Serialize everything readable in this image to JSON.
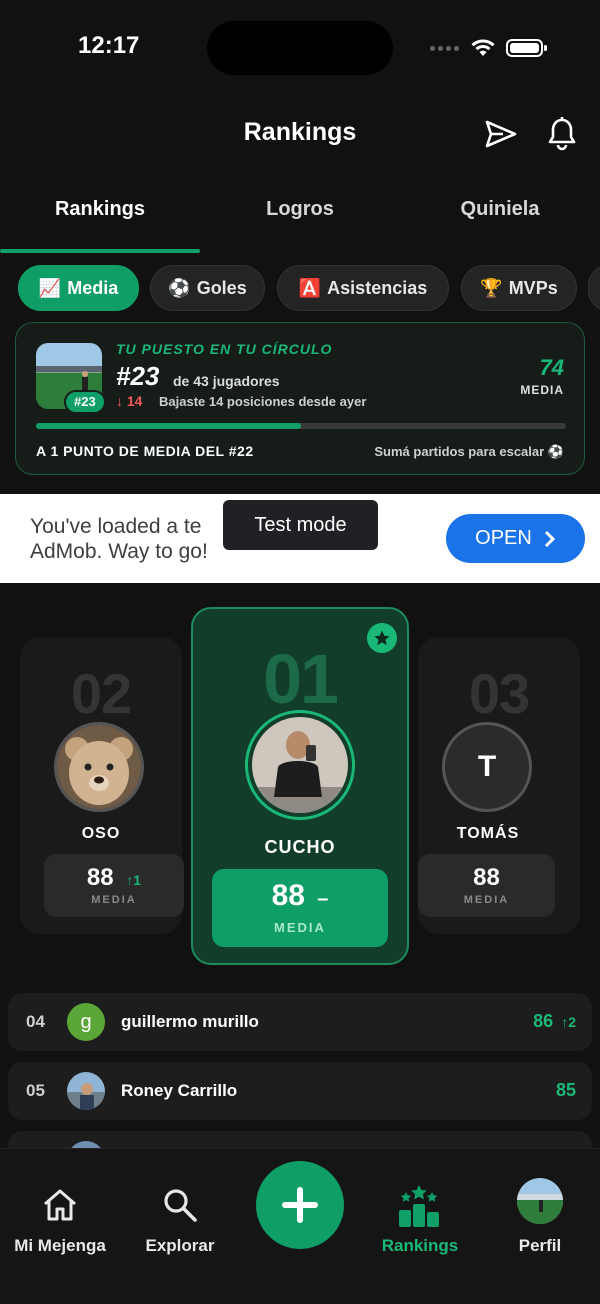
{
  "status_bar": {
    "time": "12:17"
  },
  "header": {
    "title": "Rankings"
  },
  "tabs": [
    {
      "label": "Rankings"
    },
    {
      "label": "Logros"
    },
    {
      "label": "Quiniela"
    }
  ],
  "chips": [
    {
      "icon": "📈",
      "label": "Media"
    },
    {
      "icon": "⚽",
      "label": "Goles"
    },
    {
      "icon": "🅰️",
      "label": "Asistencias"
    },
    {
      "icon": "🏆",
      "label": "MVPs"
    }
  ],
  "position_card": {
    "kicker": "TU PUESTO EN TU CÍRCULO",
    "rank": "#23",
    "of_text": "de 43 jugadores",
    "badge": "#23",
    "change": "↓ 14",
    "change_text": "Bajaste 14 posiciones desde ayer",
    "value": "74",
    "value_label": "MEDIA",
    "progress": 0.5,
    "footer_left": "A 1 PUNTO DE MEDIA DEL #22",
    "footer_right": "Sumá partidos para escalar ⚽"
  },
  "ad": {
    "text_line1": "You've loaded a te",
    "text_line2": "AdMob. Way to go!",
    "button": "OPEN",
    "test_mode": "Test mode"
  },
  "podium": {
    "first": {
      "pos": "01",
      "name": "CUCHO",
      "value": "88",
      "change": "–",
      "label": "MEDIA"
    },
    "second": {
      "pos": "02",
      "name": "OSO",
      "value": "88",
      "change": "↑1",
      "label": "MEDIA"
    },
    "third": {
      "pos": "03",
      "name": "TOMÁS",
      "initial": "T",
      "value": "88",
      "label": "MEDIA"
    }
  },
  "list": [
    {
      "pos": "04",
      "initial": "g",
      "name": "guillermo murillo",
      "value": "86",
      "change": "↑2"
    },
    {
      "pos": "05",
      "name": "Roney Carrillo",
      "value": "85"
    }
  ],
  "nav": [
    {
      "label": "Mi Mejenga"
    },
    {
      "label": "Explorar"
    },
    {
      "label": "Rankings"
    },
    {
      "label": "Perfil"
    }
  ],
  "colors": {
    "accent": "#0f9f66",
    "accent_text": "#19b877",
    "down": "#ef5b5b",
    "ad_button": "#1a73e8"
  }
}
